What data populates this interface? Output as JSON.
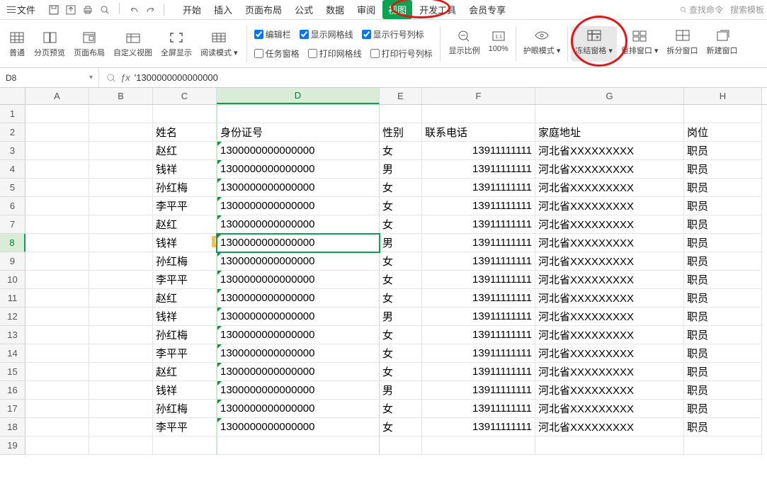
{
  "menubar": {
    "file": "文件",
    "tabs": [
      "开始",
      "插入",
      "页面布局",
      "公式",
      "数据",
      "审阅",
      "视图",
      "开发工具",
      "会员专享"
    ],
    "active_tab": "视图",
    "search_cmd": "查找命令",
    "search_tpl": "搜索模板"
  },
  "ribbon": {
    "groups": [
      {
        "label": "普通"
      },
      {
        "label": "分页预览"
      },
      {
        "label": "页面布局"
      },
      {
        "label": "自定义视图"
      },
      {
        "label": "全屏显示"
      },
      {
        "label": "阅读模式"
      }
    ],
    "checks_row1": [
      {
        "label": "编辑栏",
        "checked": true
      },
      {
        "label": "显示网格线",
        "checked": true
      },
      {
        "label": "显示行号列标",
        "checked": true
      }
    ],
    "checks_row2": [
      {
        "label": "任务窗格",
        "checked": false
      },
      {
        "label": "打印网格线",
        "checked": false
      },
      {
        "label": "打印行号列标",
        "checked": false
      }
    ],
    "groups2": [
      {
        "label": "显示比例"
      },
      {
        "label": "100%"
      },
      {
        "label": "护眼模式"
      },
      {
        "label": "冻结窗格"
      },
      {
        "label": "重排窗口"
      },
      {
        "label": "拆分窗口"
      },
      {
        "label": "新建窗口"
      }
    ]
  },
  "formula": {
    "namebox": "D8",
    "value": "'1300000000000000"
  },
  "columns": [
    "A",
    "B",
    "C",
    "D",
    "E",
    "F",
    "G",
    "H"
  ],
  "headers": {
    "C": "姓名",
    "D": "身份证号",
    "E": "性别",
    "F": "联系电话",
    "G": "家庭地址",
    "H": "岗位"
  },
  "rows": [
    {
      "n": 1
    },
    {
      "n": 2,
      "header": true
    },
    {
      "n": 3,
      "C": "赵红",
      "D": "1300000000000000",
      "E": "女",
      "F": "13911111111",
      "G": "河北省XXXXXXXXX",
      "H": "职员"
    },
    {
      "n": 4,
      "C": "钱祥",
      "D": "1300000000000000",
      "E": "男",
      "F": "13911111111",
      "G": "河北省XXXXXXXXX",
      "H": "职员"
    },
    {
      "n": 5,
      "C": "孙红梅",
      "D": "1300000000000000",
      "E": "女",
      "F": "13911111111",
      "G": "河北省XXXXXXXXX",
      "H": "职员"
    },
    {
      "n": 6,
      "C": "李平平",
      "D": "1300000000000000",
      "E": "女",
      "F": "13911111111",
      "G": "河北省XXXXXXXXX",
      "H": "职员"
    },
    {
      "n": 7,
      "C": "赵红",
      "D": "1300000000000000",
      "E": "女",
      "F": "13911111111",
      "G": "河北省XXXXXXXXX",
      "H": "职员"
    },
    {
      "n": 8,
      "C": "钱祥",
      "D": "1300000000000000",
      "E": "男",
      "F": "13911111111",
      "G": "河北省XXXXXXXXX",
      "H": "职员",
      "selected": true,
      "warn": true
    },
    {
      "n": 9,
      "C": "孙红梅",
      "D": "1300000000000000",
      "E": "女",
      "F": "13911111111",
      "G": "河北省XXXXXXXXX",
      "H": "职员"
    },
    {
      "n": 10,
      "C": "李平平",
      "D": "1300000000000000",
      "E": "女",
      "F": "13911111111",
      "G": "河北省XXXXXXXXX",
      "H": "职员"
    },
    {
      "n": 11,
      "C": "赵红",
      "D": "1300000000000000",
      "E": "女",
      "F": "13911111111",
      "G": "河北省XXXXXXXXX",
      "H": "职员"
    },
    {
      "n": 12,
      "C": "钱祥",
      "D": "1300000000000000",
      "E": "男",
      "F": "13911111111",
      "G": "河北省XXXXXXXXX",
      "H": "职员"
    },
    {
      "n": 13,
      "C": "孙红梅",
      "D": "1300000000000000",
      "E": "女",
      "F": "13911111111",
      "G": "河北省XXXXXXXXX",
      "H": "职员"
    },
    {
      "n": 14,
      "C": "李平平",
      "D": "1300000000000000",
      "E": "女",
      "F": "13911111111",
      "G": "河北省XXXXXXXXX",
      "H": "职员"
    },
    {
      "n": 15,
      "C": "赵红",
      "D": "1300000000000000",
      "E": "女",
      "F": "13911111111",
      "G": "河北省XXXXXXXXX",
      "H": "职员"
    },
    {
      "n": 16,
      "C": "钱祥",
      "D": "1300000000000000",
      "E": "男",
      "F": "13911111111",
      "G": "河北省XXXXXXXXX",
      "H": "职员"
    },
    {
      "n": 17,
      "C": "孙红梅",
      "D": "1300000000000000",
      "E": "女",
      "F": "13911111111",
      "G": "河北省XXXXXXXXX",
      "H": "职员"
    },
    {
      "n": 18,
      "C": "李平平",
      "D": "1300000000000000",
      "E": "女",
      "F": "13911111111",
      "G": "河北省XXXXXXXXX",
      "H": "职员"
    },
    {
      "n": 19
    }
  ]
}
